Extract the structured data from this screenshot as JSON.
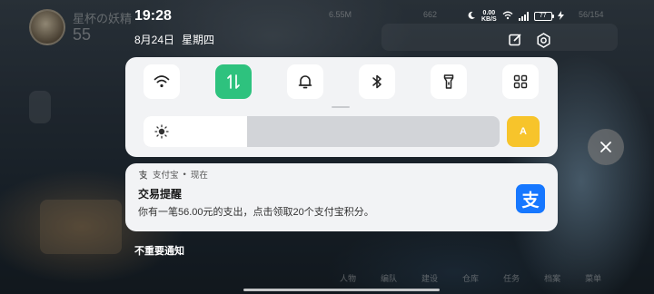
{
  "status_bar": {
    "time": "19:28",
    "date": "8月24日",
    "weekday": "星期四",
    "net_speed_value": "0.00",
    "net_speed_unit": "KB/S",
    "battery": "77"
  },
  "quick_settings": {
    "tiles": [
      {
        "icon": "wifi-icon",
        "active": false
      },
      {
        "icon": "mobile-data-icon",
        "active": true
      },
      {
        "icon": "bell-icon",
        "active": false
      },
      {
        "icon": "bluetooth-icon",
        "active": false
      },
      {
        "icon": "flashlight-icon",
        "active": false
      },
      {
        "icon": "grid-icon",
        "active": false
      }
    ],
    "brightness_level": 0.29,
    "auto_label": "A",
    "active_color": "#2ec27e",
    "auto_color": "#f7c42b"
  },
  "notification": {
    "app_name": "支付宝",
    "separator": "•",
    "time": "现在",
    "title": "交易提醒",
    "body": "你有一笔56.00元的支出，点击领取20个支付宝积分。",
    "logo_glyph": "支",
    "logo_color": "#1677ff"
  },
  "section_label": "不重要通知",
  "background": {
    "player_name": "星杯の妖精",
    "level": "55",
    "gold": "6.55M",
    "gems": "662",
    "stamina": "56/154",
    "bottom_tabs": [
      "人物",
      "编队",
      "建设",
      "仓库",
      "任务",
      "档案",
      "菜单"
    ]
  }
}
